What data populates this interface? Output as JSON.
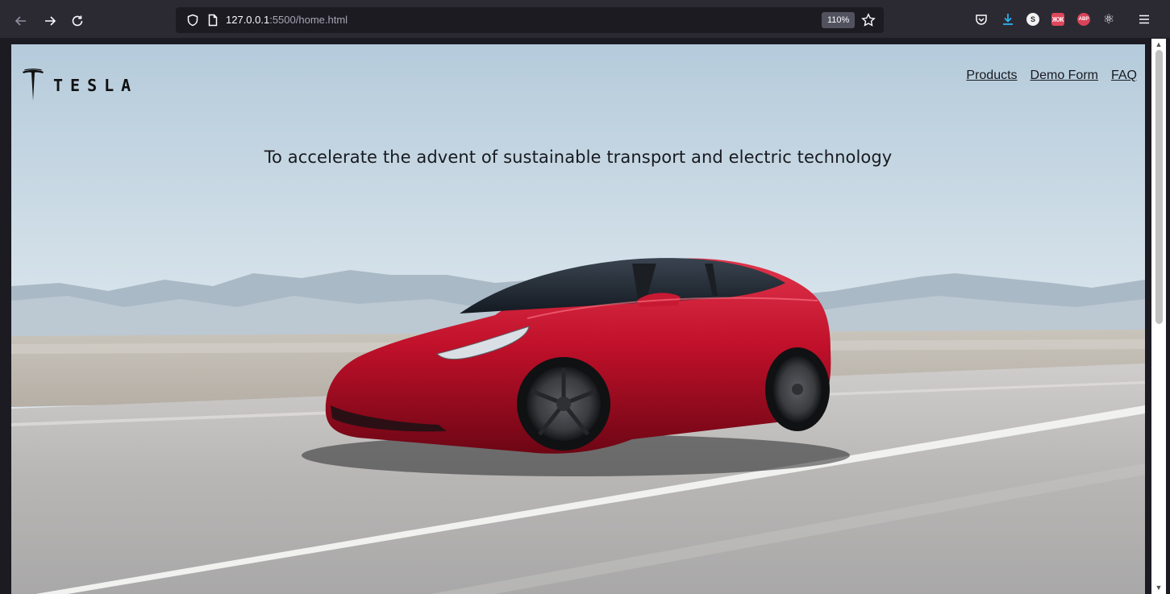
{
  "browser": {
    "url_host": "127.0.0.1",
    "url_path": ":5500/home.html",
    "zoom_level": "110%",
    "icons": {
      "back": "back-arrow-icon",
      "forward": "forward-arrow-icon",
      "reload": "reload-icon",
      "tracking_shield": "shield-icon",
      "page_info": "page-icon",
      "bookmark": "star-icon",
      "pocket": "pocket-icon",
      "downloads": "download-icon",
      "menu": "hamburger-menu-icon"
    },
    "extensions": [
      {
        "name": "s-extension-icon",
        "glyph": "S",
        "color": "#e6e6e6"
      },
      {
        "name": "grid-extension-icon",
        "glyph": "ЖЖ",
        "color": "#e0465b"
      },
      {
        "name": "adblock-plus-icon",
        "glyph": "ABP",
        "color": "#d94359"
      },
      {
        "name": "react-devtools-icon",
        "glyph": "⚛",
        "color": "#fbfbfe"
      }
    ]
  },
  "page": {
    "logo_text": "TESLA",
    "nav": [
      {
        "label": "Products"
      },
      {
        "label": "Demo Form"
      },
      {
        "label": "FAQ"
      }
    ],
    "mission_statement": "To accelerate the advent of sustainable transport and electric technology",
    "hero_image": "red-sedan-on-desert-road",
    "colors": {
      "car_red": "#c0102a",
      "sky": "#cfdde7",
      "road": "#b9b7b6",
      "text": "#171a20"
    }
  }
}
